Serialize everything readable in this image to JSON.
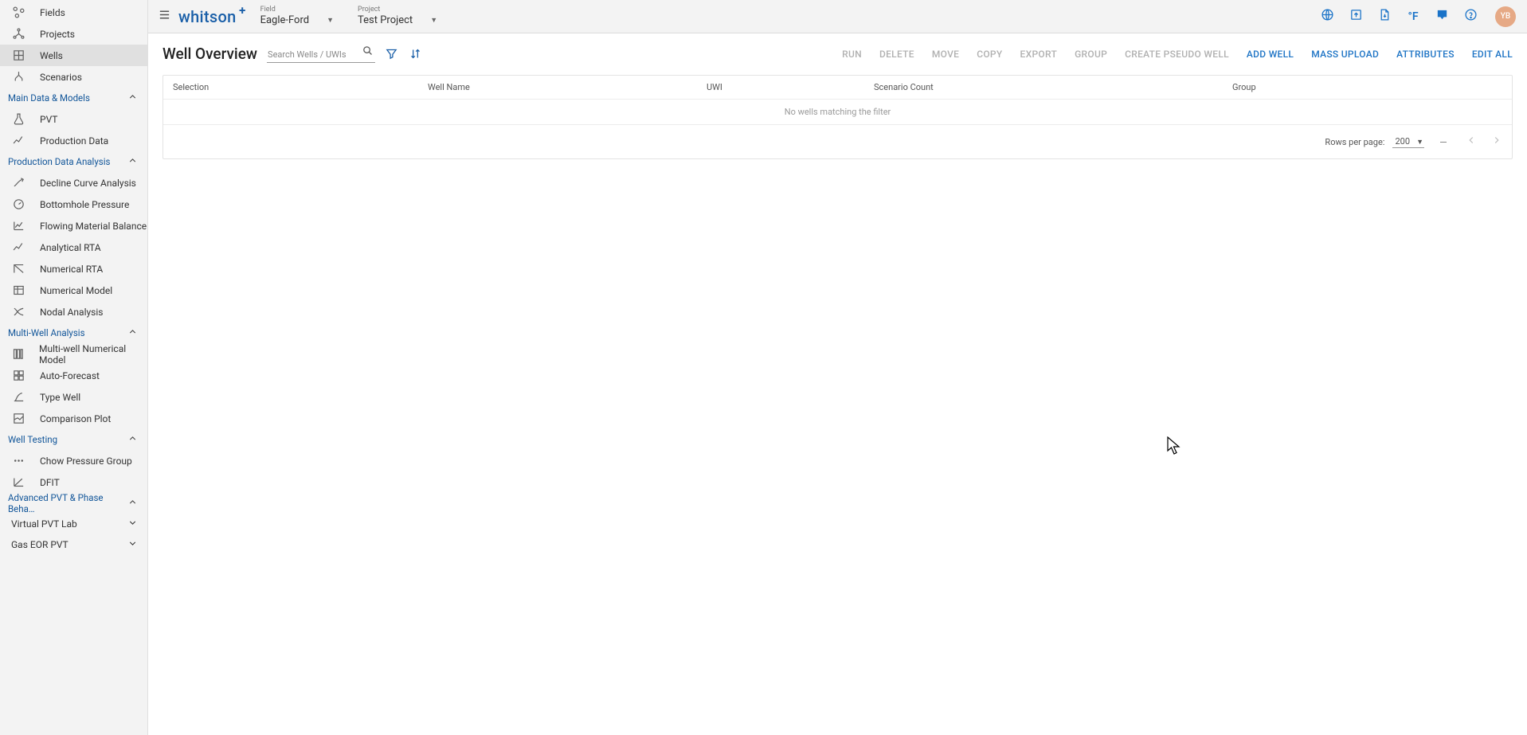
{
  "brand": {
    "name": "whitson",
    "sup": "+"
  },
  "topbar": {
    "field_label": "Field",
    "field_value": "Eagle-Ford",
    "project_label": "Project",
    "project_value": "Test Project",
    "temp_unit": "°F",
    "avatar_initials": "YB"
  },
  "sidebar": {
    "root": [
      {
        "label": "Fields",
        "icon": "workspaces",
        "active": false
      },
      {
        "label": "Projects",
        "icon": "hub",
        "active": false
      },
      {
        "label": "Wells",
        "icon": "grid",
        "active": true
      },
      {
        "label": "Scenarios",
        "icon": "tree",
        "active": false
      }
    ],
    "groups": [
      {
        "label": "Main Data & Models",
        "expanded": true,
        "items": [
          {
            "label": "PVT",
            "icon": "flask"
          },
          {
            "label": "Production Data",
            "icon": "line"
          }
        ]
      },
      {
        "label": "Production Data Analysis",
        "expanded": true,
        "items": [
          {
            "label": "Decline Curve Analysis",
            "icon": "dca"
          },
          {
            "label": "Bottomhole Pressure",
            "icon": "gauge"
          },
          {
            "label": "Flowing Material Balance",
            "icon": "linechart"
          },
          {
            "label": "Analytical RTA",
            "icon": "line"
          },
          {
            "label": "Numerical RTA",
            "icon": "numrta"
          },
          {
            "label": "Numerical Model",
            "icon": "table"
          },
          {
            "label": "Nodal Analysis",
            "icon": "nodal"
          }
        ]
      },
      {
        "label": "Multi-Well Analysis",
        "expanded": true,
        "items": [
          {
            "label": "Multi-well Numerical Model",
            "icon": "columns"
          },
          {
            "label": "Auto-Forecast",
            "icon": "grid4"
          },
          {
            "label": "Type Well",
            "icon": "typewell"
          },
          {
            "label": "Comparison Plot",
            "icon": "compare"
          }
        ]
      },
      {
        "label": "Well Testing",
        "expanded": true,
        "items": [
          {
            "label": "Chow Pressure Group",
            "icon": "dots"
          },
          {
            "label": "DFIT",
            "icon": "dfit"
          }
        ]
      },
      {
        "label": "Advanced PVT & Phase Beha…",
        "expanded": true,
        "items": [],
        "subgroups": [
          {
            "label": "Virtual PVT Lab",
            "expanded": false
          },
          {
            "label": "Gas EOR PVT",
            "expanded": false
          }
        ]
      }
    ]
  },
  "page": {
    "title": "Well Overview",
    "search_placeholder": "Search Wells / UWIs",
    "actions": {
      "run": "RUN",
      "delete": "DELETE",
      "move": "MOVE",
      "copy": "COPY",
      "export": "EXPORT",
      "group": "GROUP",
      "create_pseudo": "CREATE PSEUDO WELL",
      "add_well": "ADD WELL",
      "mass_upload": "MASS UPLOAD",
      "attributes": "ATTRIBUTES",
      "edit_all": "EDIT ALL"
    }
  },
  "table": {
    "columns": {
      "selection": "Selection",
      "well_name": "Well Name",
      "uwi": "UWI",
      "scenario_count": "Scenario Count",
      "group": "Group"
    },
    "empty_text": "No wells matching the filter",
    "footer": {
      "rows_label": "Rows per page:",
      "rows_value": "200"
    }
  }
}
